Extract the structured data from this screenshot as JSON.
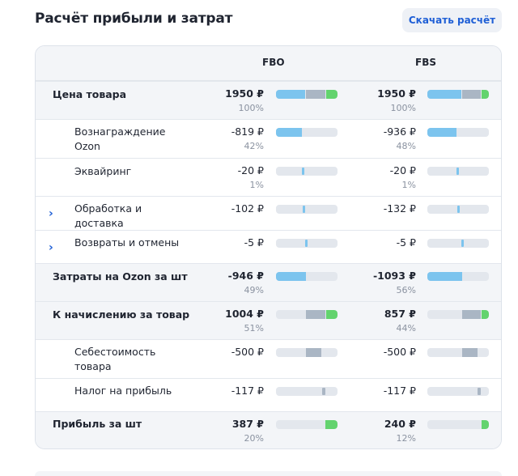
{
  "header": {
    "title": "Расчёт прибыли и затрат",
    "download_label": "Скачать расчёт"
  },
  "columns": {
    "fbo": "FBO",
    "fbs": "FBS"
  },
  "rows": [
    {
      "label": "Цена товара",
      "fbo": {
        "amount": "1950 ₽",
        "pct": "100%"
      },
      "fbs": {
        "amount": "1950 ₽",
        "pct": "100%"
      }
    },
    {
      "label": "Вознаграждение Ozon",
      "fbo": {
        "amount": "-819 ₽",
        "pct": "42%"
      },
      "fbs": {
        "amount": "-936 ₽",
        "pct": "48%"
      }
    },
    {
      "label": "Эквайринг",
      "fbo": {
        "amount": "-20 ₽",
        "pct": "1%"
      },
      "fbs": {
        "amount": "-20 ₽",
        "pct": "1%"
      }
    },
    {
      "label": "Обработка  и доставка",
      "fbo": {
        "amount": "-102 ₽"
      },
      "fbs": {
        "amount": "-132 ₽"
      }
    },
    {
      "label": "Возвраты и отмены",
      "fbo": {
        "amount": "-5 ₽"
      },
      "fbs": {
        "amount": "-5 ₽"
      }
    },
    {
      "label": "Затраты на Ozon за шт",
      "fbo": {
        "amount": "-946 ₽",
        "pct": "49%"
      },
      "fbs": {
        "amount": "-1093 ₽",
        "pct": "56%"
      }
    },
    {
      "label": "К начислению за товар",
      "fbo": {
        "amount": "1004 ₽",
        "pct": "51%"
      },
      "fbs": {
        "amount": "857 ₽",
        "pct": "44%"
      }
    },
    {
      "label": "Себестоимость товара",
      "fbo": {
        "amount": "-500 ₽"
      },
      "fbs": {
        "amount": "-500 ₽"
      }
    },
    {
      "label": "Налог на прибыль",
      "fbo": {
        "amount": "-117 ₽"
      },
      "fbs": {
        "amount": "-117 ₽"
      }
    },
    {
      "label": "Прибыль за шт",
      "fbo": {
        "amount": "387 ₽",
        "pct": "20%"
      },
      "fbs": {
        "amount": "240 ₽",
        "pct": "12%"
      }
    }
  ],
  "colors": {
    "blue": "#7cc4ee",
    "grey": "#aab6c4",
    "green": "#63d36e",
    "accent": "#1f5fd6"
  },
  "icons": {
    "expand": "chevron-right-icon"
  }
}
